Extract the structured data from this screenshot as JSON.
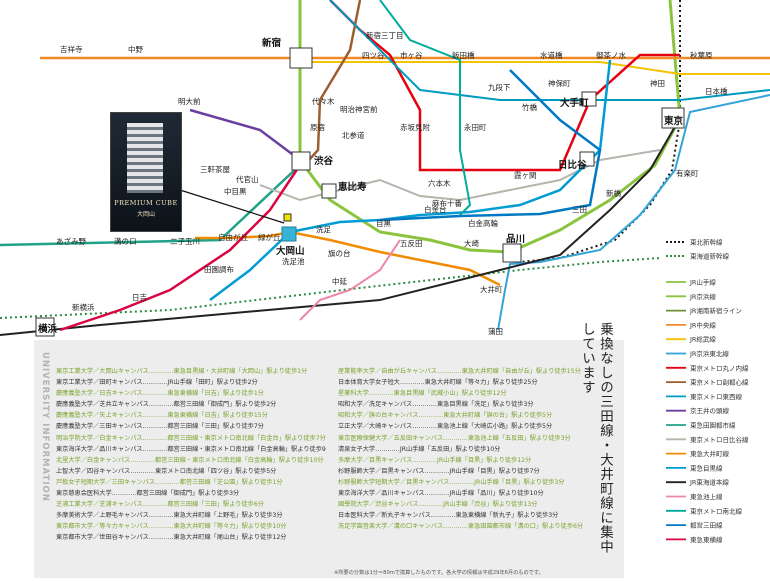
{
  "property": {
    "name_en": "PREMIUM CUBE",
    "name_jp": "大岡山"
  },
  "stations": {
    "shinjuku": "新宿",
    "shinjuku_sanchome": "新宿三丁目",
    "yotsuya": "四ツ谷",
    "ichigaya": "市ヶ谷",
    "iidabashi": "飯田橋",
    "suidobashi": "水道橋",
    "ochanomizu": "御茶ノ水",
    "akihabara": "秋葉原",
    "kichijoji": "吉祥寺",
    "nakano": "中野",
    "kudanshita": "九段下",
    "jimbocho": "神保町",
    "kanda": "神田",
    "nihonbashi": "日本橋",
    "meidaimae": "明大前",
    "yoyogi": "代々木",
    "meijijingumae": "明治神宮前",
    "takebashi": "竹橋",
    "otemachi": "大手町",
    "tokyo": "東京",
    "harajuku": "原宿",
    "kitasando": "北参道",
    "akasakamitsuke": "赤坂見附",
    "nagatacho": "永田町",
    "sangenjaya": "三軒茶屋",
    "shibuya": "渋谷",
    "hibiya": "日比谷",
    "daikanyama": "代官山",
    "nakameguro": "中目黒",
    "ebisu": "恵比寿",
    "roppongi": "六本木",
    "kasumigaseki": "霞ヶ関",
    "yurakucho": "有楽町",
    "azabujuban": "麻布十番",
    "shimbashi": "新橋",
    "jiyugaoka": "自由が丘",
    "midorigaoka": "緑が丘",
    "shirokanedai": "白金台",
    "shirokanetakanawa": "白金高輪",
    "mita": "三田",
    "azamino": "あざみ野",
    "mizonokuchi": "溝の口",
    "futakotamagawa": "二子玉川",
    "ookayama": "大岡山",
    "senzoku": "洗足",
    "meguro": "目黒",
    "gotanda": "五反田",
    "denenchofu": "田園調布",
    "senzokuike": "洗足池",
    "hatanodai": "旗の台",
    "osaki": "大崎",
    "shinagawa": "品川",
    "nakanobu": "中延",
    "oimachi": "大井町",
    "shinyokohama": "新横浜",
    "hiyoshi": "日吉",
    "yokohama": "横浜",
    "kamata": "蒲田"
  },
  "legend": {
    "shinkansen": [
      {
        "label": "東北新幹線",
        "color": "#1a1a1a"
      },
      {
        "label": "東海道新幹線",
        "color": "#2e8b3d"
      }
    ],
    "lines": [
      {
        "label": "JR山手線",
        "color": "#8ac43f"
      },
      {
        "label": "JR京浜線",
        "color": "#8ac43f"
      },
      {
        "label": "JR湘南新宿ライン",
        "color": "#6e8f3a"
      },
      {
        "label": "JR中央線",
        "color": "#f08a24"
      },
      {
        "label": "JR総武線",
        "color": "#f2c400"
      },
      {
        "label": "JR京浜東北線",
        "color": "#33a4d8"
      },
      {
        "label": "東京メトロ丸ノ内線",
        "color": "#e60012"
      },
      {
        "label": "東京メトロ副都心線",
        "color": "#9c5e31"
      },
      {
        "label": "東京メトロ東西線",
        "color": "#009bbf"
      },
      {
        "label": "京王井の頭線",
        "color": "#6b3fa0"
      },
      {
        "label": "東急田園都市線",
        "color": "#20a288"
      },
      {
        "label": "東京メトロ日比谷線",
        "color": "#b5b5ac"
      },
      {
        "label": "東急大井町線",
        "color": "#f18c00"
      },
      {
        "label": "東急目黒線",
        "color": "#009cd2"
      },
      {
        "label": "JR東海道本線",
        "color": "#222222"
      },
      {
        "label": "東急池上線",
        "color": "#ee86a7"
      },
      {
        "label": "東京メトロ南北線",
        "color": "#00ac9b"
      },
      {
        "label": "都営三田線",
        "color": "#0079c2"
      },
      {
        "label": "東急東横線",
        "color": "#da0442"
      }
    ]
  },
  "university": {
    "title": "UNIVERSITY INFORMATION",
    "left": [
      {
        "text": "東京工業大学／大岡山キャンパス…………東急目黒線・大井町線「大岡山」駅より徒歩1分",
        "hl": true
      },
      {
        "text": "東京工業大学／田町キャンパス…………JR山手線「田町」駅より徒歩2分",
        "hl": false
      },
      {
        "text": "慶應義塾大学／日吉キャンパス…………東急東横線「日吉」駅より徒歩1分",
        "hl": true
      },
      {
        "text": "慶應義塾大学／芝共立キャンパス…………都営三田線「御成門」駅より徒歩2分",
        "hl": false
      },
      {
        "text": "慶應義塾大学／矢上キャンパス…………東急東横線「日吉」駅より徒歩15分",
        "hl": true
      },
      {
        "text": "慶應義塾大学／三田キャンパス…………都営三田線「三田」駅より徒歩7分",
        "hl": false
      },
      {
        "text": "明治学院大学／白金キャンパス…………都営三田線・東京メトロ南北線「白金台」駅より徒歩7分",
        "hl": true
      },
      {
        "text": "東京海洋大学／品川キャンパス…………都営三田線・東京メトロ南北線「白金高輪」駅より徒歩9分",
        "hl": false
      },
      {
        "text": "北里大学／白金キャンパス…………都営三田線・東京メトロ南北線「白金高輪」駅より徒歩10分",
        "hl": true
      },
      {
        "text": "上智大学／四谷キャンパス…………東京メトロ南北線「四ツ谷」駅より徒歩5分",
        "hl": false
      },
      {
        "text": "戸板女子短期大学／三田キャンパス…………都営三田線「芝公園」駅より徒歩1分",
        "hl": true
      },
      {
        "text": "東京慈恵会医科大学…………都営三田線「御成門」駅より徒歩3分",
        "hl": false
      },
      {
        "text": "芝浦工業大学／芝浦キャンパス…………都営三田線「三田」駅より徒歩6分",
        "hl": true
      },
      {
        "text": "多摩美術大学／上野毛キャンパス…………東急大井町線「上野毛」駅より徒歩3分",
        "hl": false
      },
      {
        "text": "東京都市大学／等々力キャンパス…………東急大井町線「等々力」駅より徒歩10分",
        "hl": true
      },
      {
        "text": "東京都市大学／世田谷キャンパス…………東急大井町線「尾山台」駅より徒歩12分",
        "hl": false
      }
    ],
    "right": [
      {
        "text": "産業能率大学／自由が丘キャンパス…………東急大井町線「自由が丘」駅より徒歩15分",
        "hl": true
      },
      {
        "text": "日本体育大学女子短大…………東急大井町線「等々力」駅より徒歩25分",
        "hl": false
      },
      {
        "text": "星薬科大学…………東急目黒線「武蔵小山」駅より徒歩12分",
        "hl": true
      },
      {
        "text": "昭和大学／洗足キャンパス…………東急目黒線「洗足」駅より徒歩3分",
        "hl": false
      },
      {
        "text": "昭和大学／旗の台キャンパス…………東急大井町線「旗の台」駅より徒歩5分",
        "hl": true
      },
      {
        "text": "立正大学／大崎キャンパス…………東急池上線「大崎広小路」駅より徒歩5分",
        "hl": false
      },
      {
        "text": "東京医療保健大学／五反田キャンパス…………東急池上線「五反田」駅より徒歩3分",
        "hl": true
      },
      {
        "text": "清泉女子大学…………JR山手線「五反田」駅より徒歩10分",
        "hl": false
      },
      {
        "text": "多摩大学／目黒キャンパス…………JR山手線「目黒」駅より徒歩12分",
        "hl": true
      },
      {
        "text": "杉野服飾大学／目黒キャンパス…………JR山手線「目黒」駅より徒歩7分",
        "hl": false
      },
      {
        "text": "杉野服飾大学短期大学／目黒キャンパス…………JR山手線「目黒」駅より徒歩3分",
        "hl": true
      },
      {
        "text": "東京海洋大学／品川キャンパス…………JR山手線「品川」駅より徒歩10分",
        "hl": false
      },
      {
        "text": "國學院大学／渋谷キャンパス…………JR山手線「渋谷」駅より徒歩13分",
        "hl": true
      },
      {
        "text": "日本医科大学／新丸子キャンパス…………東急東横線「新丸子」駅より徒歩3分",
        "hl": false
      },
      {
        "text": "洗足学園音楽大学／溝の口キャンパス…………東急田園都市線「溝の口」駅より徒歩6分",
        "hl": true
      }
    ],
    "note": "※所要の分数は1分＝80mで換算したものです。各大学の情報は平成29年6月のものです。"
  },
  "catchcopy": "乗換なしの三田線・大井町線に集中しています"
}
